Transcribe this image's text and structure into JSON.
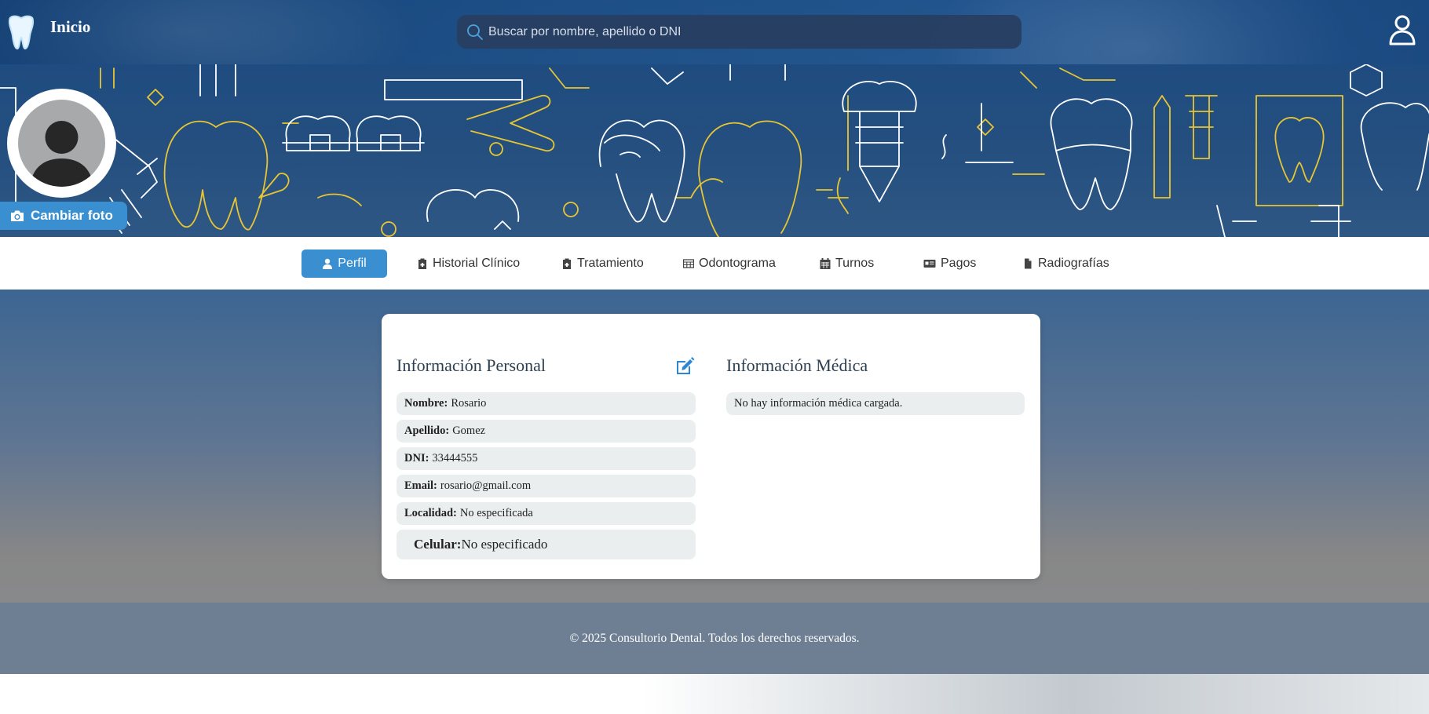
{
  "header": {
    "home_label": "Inicio",
    "search_placeholder": "Buscar por nombre, apellido o DNI"
  },
  "profile": {
    "change_photo_label": "Cambiar foto"
  },
  "tabs": [
    {
      "label": "Perfil",
      "icon": "user-icon",
      "active": true
    },
    {
      "label": "Historial Clínico",
      "icon": "file-medical-icon",
      "active": false
    },
    {
      "label": "Tratamiento",
      "icon": "file-medical-icon",
      "active": false
    },
    {
      "label": "Odontograma",
      "icon": "table-icon",
      "active": false
    },
    {
      "label": "Turnos",
      "icon": "calendar-icon",
      "active": false
    },
    {
      "label": "Pagos",
      "icon": "id-card-icon",
      "active": false
    },
    {
      "label": "Radiografías",
      "icon": "file-image-icon",
      "active": false
    }
  ],
  "personal": {
    "title": "Información Personal",
    "fields": [
      {
        "label": "Nombre:",
        "value": "Rosario"
      },
      {
        "label": "Apellido:",
        "value": "Gomez"
      },
      {
        "label": "DNI:",
        "value": "33444555"
      },
      {
        "label": "Email:",
        "value": "rosario@gmail.com"
      },
      {
        "label": "Localidad:",
        "value": "No especificada"
      },
      {
        "label": "Celular:",
        "value": "No especificado"
      }
    ]
  },
  "medical": {
    "title": "Información Médica",
    "empty_text": "No hay información médica cargada."
  },
  "footer": {
    "text": "© 2025 Consultorio Dental. Todos los derechos reservados."
  },
  "colors": {
    "accent": "#3a8fd0",
    "banner_line_yellow": "#e8c532",
    "banner_line_white": "#ffffff"
  }
}
